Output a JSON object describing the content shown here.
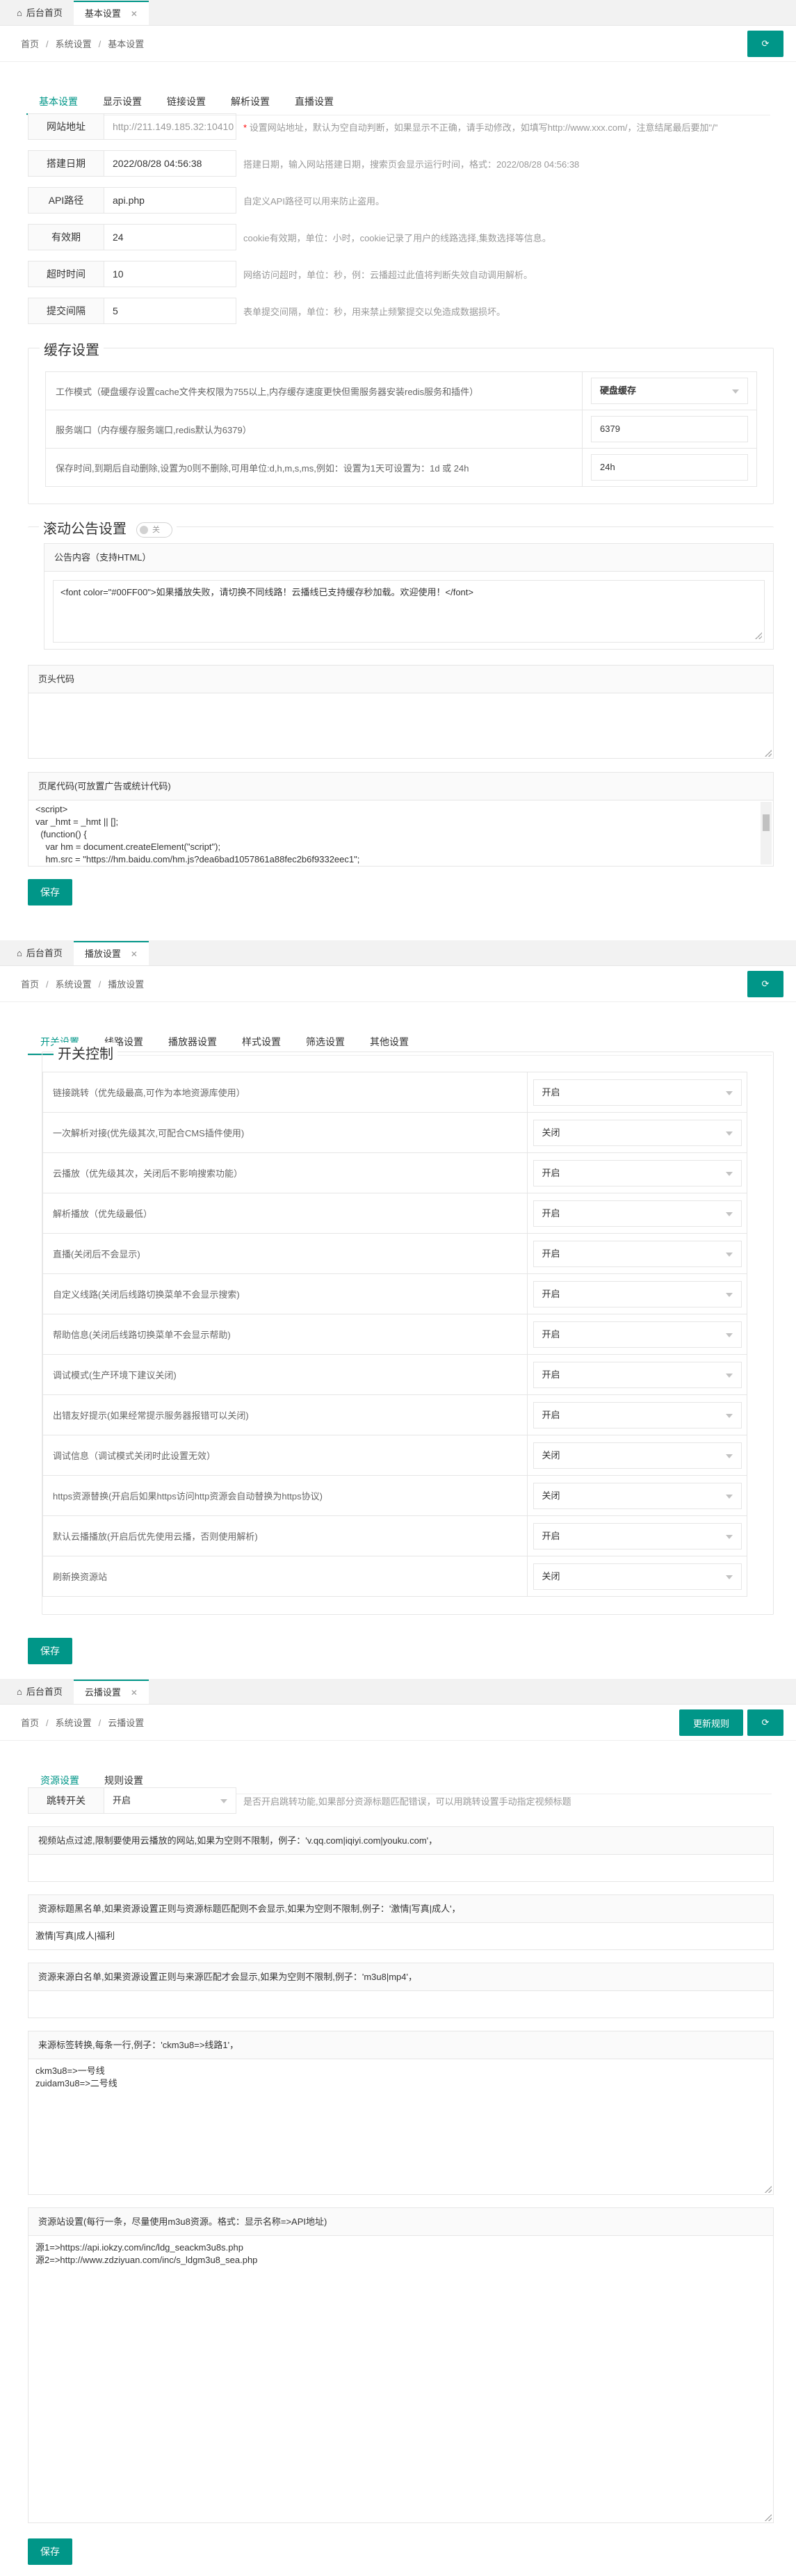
{
  "colors": {
    "accent": "#009688",
    "hint": "#999999",
    "red": "#ff0000"
  },
  "icons": {
    "home": "home-icon",
    "refresh": "refresh-icon",
    "close": "close-icon",
    "caret": "caret-down-icon"
  },
  "p1": {
    "home_tab": "后台首页",
    "active_tab": "基本设置",
    "breadcrumb": [
      "首页",
      "系统设置",
      "基本设置"
    ],
    "subtabs": [
      "基本设置",
      "显示设置",
      "链接设置",
      "解析设置",
      "直播设置"
    ],
    "fields": [
      {
        "label": "网站地址",
        "value": "http://211.149.185.32:10410",
        "hint_red": "*",
        "hint": "设置网站地址，默认为空自动判断，如果显示不正确，请手动修改，如填写http://www.xxx.com/，注意结尾最后要加\"/\""
      },
      {
        "label": "搭建日期",
        "value": "2022/08/28 04:56:38",
        "hint_red": "",
        "hint": "搭建日期，输入网站搭建日期，搜索页会显示运行时间，格式：2022/08/28 04:56:38"
      },
      {
        "label": "API路径",
        "value": "api.php",
        "hint_red": "",
        "hint": "自定义API路径可以用来防止盗用。"
      },
      {
        "label": "有效期",
        "value": "24",
        "hint_red": "",
        "hint": "cookie有效期，单位：小时，cookie记录了用户的线路选择,集数选择等信息。"
      },
      {
        "label": "超时时间",
        "value": "10",
        "hint_red": "",
        "hint": "网络访问超时，单位：秒，例：云播超过此值将判断失效自动调用解析。"
      },
      {
        "label": "提交间隔",
        "value": "5",
        "hint_red": "",
        "hint": "表单提交间隔，单位：秒，用来禁止频繁提交以免造成数据损坏。"
      }
    ],
    "cache_legend": "缓存设置",
    "cache_rows": [
      {
        "label": "工作模式（硬盘缓存设置cache文件夹权限为755以上,内存缓存速度更快但需服务器安装redis服务和插件）",
        "value": "硬盘缓存",
        "type": "select"
      },
      {
        "label": "服务端口（内存缓存服务端口,redis默认为6379）",
        "value": "6379",
        "type": "input"
      },
      {
        "label": "保存时间,到期后自动删除,设置为0则不删除,可用单位:d,h,m,s,ms,例如：设置为1天可设置为：1d 或 24h",
        "value": "24h",
        "type": "input"
      }
    ],
    "notice_legend": "滚动公告设置",
    "notice_switch": "关",
    "notice_card_title": "公告内容（支持HTML）",
    "notice_content": "<font color=\"#00FF00\">如果播放失败，请切换不同线路！云播线已支持缓存秒加载。欢迎使用！</font>",
    "header_code_title": "页头代码",
    "footer_code_title": "页尾代码(可放置广告或统计代码)",
    "footer_code": "<script>\nvar _hmt = _hmt || [];\n  (function() {\n    var hm = document.createElement(\"script\");\n    hm.src = \"https://hm.baidu.com/hm.js?dea6bad1057861a88fec2b6f9332eec1\";",
    "save": "保存"
  },
  "p2": {
    "home_tab": "后台首页",
    "active_tab": "播放设置",
    "breadcrumb": [
      "首页",
      "系统设置",
      "播放设置"
    ],
    "subtabs": [
      "开关设置",
      "线路设置",
      "播放器设置",
      "样式设置",
      "筛选设置",
      "其他设置"
    ],
    "legend": "开关控制",
    "rows": [
      {
        "label": "链接跳转（优先级最高,可作为本地资源库使用）",
        "value": "开启"
      },
      {
        "label": "一次解析对接(优先级其次,可配合CMS插件使用)",
        "value": "关闭"
      },
      {
        "label": "云播放（优先级其次，关闭后不影响搜索功能）",
        "value": "开启"
      },
      {
        "label": "解析播放（优先级最低）",
        "value": "开启"
      },
      {
        "label": "直播(关闭后不会显示)",
        "value": "开启"
      },
      {
        "label": "自定义线路(关闭后线路切换菜单不会显示搜索)",
        "value": "开启"
      },
      {
        "label": "帮助信息(关闭后线路切换菜单不会显示帮助)",
        "value": "开启"
      },
      {
        "label": "调试模式(生产环境下建议关闭)",
        "value": "开启"
      },
      {
        "label": "出错友好提示(如果经常提示服务器报错可以关闭)",
        "value": "开启"
      },
      {
        "label": "调试信息（调试模式关闭时此设置无效）",
        "value": "关闭"
      },
      {
        "label": "https资源替换(开启后如果https访问http资源会自动替换为https协议)",
        "value": "关闭"
      },
      {
        "label": "默认云播播放(开启后优先使用云播，否则使用解析)",
        "value": "开启"
      },
      {
        "label": "刷新换资源站",
        "value": "关闭"
      }
    ],
    "save": "保存"
  },
  "p3": {
    "home_tab": "后台首页",
    "active_tab": "云播设置",
    "breadcrumb": [
      "首页",
      "系统设置",
      "云播设置"
    ],
    "update_btn": "更新规则",
    "subtabs": [
      "资源设置",
      "规则设置"
    ],
    "jump_label": "跳转开关",
    "jump_value": "开启",
    "jump_hint": "是否开启跳转功能,如果部分资源标题匹配错误，可以用跳转设置手动指定视频标题",
    "cards": [
      {
        "title": "视频站点过滤,限制要使用云播放的网站,如果为空则不限制，例子：'v.qq.com|iqiyi.com|youku.com'，",
        "content": ""
      },
      {
        "title": "资源标题黑名单,如果资源设置正则与资源标题匹配则不会显示,如果为空则不限制,例子：'激情|写真|成人'，",
        "content": "激情|写真|成人|福利"
      },
      {
        "title": "资源来源白名单,如果资源设置正则与来源匹配才会显示,如果为空则不限制,例子：'m3u8|mp4'，",
        "content": ""
      }
    ],
    "source_title": "来源标签转换,每条一行,例子：'ckm3u8=>线路1'，",
    "source_content": "ckm3u8=>一号线\nzuidam3u8=>二号线",
    "api_title": "资源站设置(每行一条，尽量使用m3u8资源。格式：显示名称=>API地址)",
    "api_content": "源1=>https://api.iokzy.com/inc/ldg_seackm3u8s.php\n源2=>http://www.zdziyuan.com/inc/s_ldgm3u8_sea.php",
    "save": "保存"
  }
}
